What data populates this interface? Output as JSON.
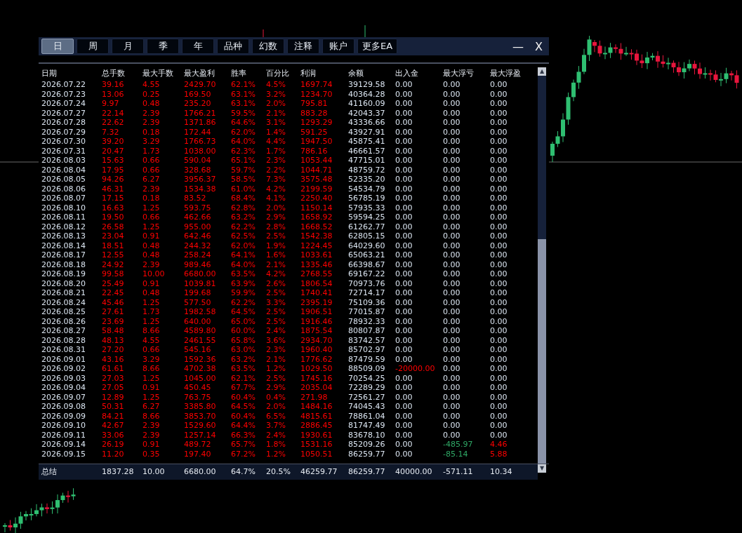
{
  "tabs": [
    {
      "label": "日",
      "selected": true
    },
    {
      "label": "周",
      "selected": false
    },
    {
      "label": "月",
      "selected": false
    },
    {
      "label": "季",
      "selected": false
    },
    {
      "label": "年",
      "selected": false
    },
    {
      "label": "品种",
      "selected": false
    },
    {
      "label": "幻数",
      "selected": false
    },
    {
      "label": "注释",
      "selected": false
    },
    {
      "label": "账户",
      "selected": false
    },
    {
      "label": "更多EA",
      "selected": false
    }
  ],
  "window_controls": {
    "minimize": "—",
    "close": "X"
  },
  "table": {
    "columns": [
      {
        "label": "日期",
        "color": "#dce6f2"
      },
      {
        "label": "总手数",
        "color": "#ff0000"
      },
      {
        "label": "最大手数",
        "color": "#ff0000"
      },
      {
        "label": "最大盈利",
        "color": "#ff0000"
      },
      {
        "label": "胜率",
        "color": "#ff0000"
      },
      {
        "label": "百分比",
        "color": "#ff0000"
      },
      {
        "label": "利润",
        "color": "#ff0000"
      },
      {
        "label": "余额",
        "color": "#dce6f2"
      },
      {
        "label": "出入金",
        "color": "#dce6f2"
      },
      {
        "label": "最大浮亏",
        "color": "#dce6f2"
      },
      {
        "label": "最大浮盈",
        "color": "#dce6f2"
      }
    ],
    "rows": [
      [
        "2026.07.22",
        "39.16",
        "4.55",
        "2429.70",
        "62.1%",
        "4.5%",
        "1697.74",
        "39129.58",
        "0.00",
        "0.00",
        "0.00"
      ],
      [
        "2026.07.23",
        "13.06",
        "0.25",
        "169.50",
        "63.1%",
        "3.2%",
        "1234.70",
        "40364.28",
        "0.00",
        "0.00",
        "0.00"
      ],
      [
        "2026.07.24",
        "9.97",
        "0.48",
        "235.20",
        "63.1%",
        "2.0%",
        "795.81",
        "41160.09",
        "0.00",
        "0.00",
        "0.00"
      ],
      [
        "2026.07.27",
        "22.14",
        "2.39",
        "1766.21",
        "59.5%",
        "2.1%",
        "883.28",
        "42043.37",
        "0.00",
        "0.00",
        "0.00"
      ],
      [
        "2026.07.28",
        "22.62",
        "2.39",
        "1371.86",
        "64.6%",
        "3.1%",
        "1293.29",
        "43336.66",
        "0.00",
        "0.00",
        "0.00"
      ],
      [
        "2026.07.29",
        "7.32",
        "0.18",
        "172.44",
        "62.0%",
        "1.4%",
        "591.25",
        "43927.91",
        "0.00",
        "0.00",
        "0.00"
      ],
      [
        "2026.07.30",
        "39.20",
        "3.29",
        "1766.73",
        "64.0%",
        "4.4%",
        "1947.50",
        "45875.41",
        "0.00",
        "0.00",
        "0.00"
      ],
      [
        "2026.07.31",
        "20.47",
        "1.73",
        "1038.00",
        "62.3%",
        "1.7%",
        "786.16",
        "46661.57",
        "0.00",
        "0.00",
        "0.00"
      ],
      [
        "2026.08.03",
        "15.63",
        "0.66",
        "590.04",
        "65.1%",
        "2.3%",
        "1053.44",
        "47715.01",
        "0.00",
        "0.00",
        "0.00"
      ],
      [
        "2026.08.04",
        "17.95",
        "0.66",
        "328.68",
        "59.7%",
        "2.2%",
        "1044.71",
        "48759.72",
        "0.00",
        "0.00",
        "0.00"
      ],
      [
        "2026.08.05",
        "94.26",
        "6.27",
        "3956.37",
        "58.5%",
        "7.3%",
        "3575.48",
        "52335.20",
        "0.00",
        "0.00",
        "0.00"
      ],
      [
        "2026.08.06",
        "46.31",
        "2.39",
        "1534.38",
        "61.0%",
        "4.2%",
        "2199.59",
        "54534.79",
        "0.00",
        "0.00",
        "0.00"
      ],
      [
        "2026.08.07",
        "17.15",
        "0.18",
        "83.52",
        "68.4%",
        "4.1%",
        "2250.40",
        "56785.19",
        "0.00",
        "0.00",
        "0.00"
      ],
      [
        "2026.08.10",
        "16.63",
        "1.25",
        "593.75",
        "62.8%",
        "2.0%",
        "1150.14",
        "57935.33",
        "0.00",
        "0.00",
        "0.00"
      ],
      [
        "2026.08.11",
        "19.50",
        "0.66",
        "462.66",
        "63.2%",
        "2.9%",
        "1658.92",
        "59594.25",
        "0.00",
        "0.00",
        "0.00"
      ],
      [
        "2026.08.12",
        "26.58",
        "1.25",
        "955.00",
        "62.2%",
        "2.8%",
        "1668.52",
        "61262.77",
        "0.00",
        "0.00",
        "0.00"
      ],
      [
        "2026.08.13",
        "23.04",
        "0.91",
        "642.46",
        "62.5%",
        "2.5%",
        "1542.38",
        "62805.15",
        "0.00",
        "0.00",
        "0.00"
      ],
      [
        "2026.08.14",
        "18.51",
        "0.48",
        "244.32",
        "62.0%",
        "1.9%",
        "1224.45",
        "64029.60",
        "0.00",
        "0.00",
        "0.00"
      ],
      [
        "2026.08.17",
        "12.55",
        "0.48",
        "258.24",
        "64.1%",
        "1.6%",
        "1033.61",
        "65063.21",
        "0.00",
        "0.00",
        "0.00"
      ],
      [
        "2026.08.18",
        "24.92",
        "2.39",
        "989.46",
        "64.0%",
        "2.1%",
        "1335.46",
        "66398.67",
        "0.00",
        "0.00",
        "0.00"
      ],
      [
        "2026.08.19",
        "99.58",
        "10.00",
        "6680.00",
        "63.5%",
        "4.2%",
        "2768.55",
        "69167.22",
        "0.00",
        "0.00",
        "0.00"
      ],
      [
        "2026.08.20",
        "25.49",
        "0.91",
        "1039.81",
        "63.9%",
        "2.6%",
        "1806.54",
        "70973.76",
        "0.00",
        "0.00",
        "0.00"
      ],
      [
        "2026.08.21",
        "22.45",
        "0.48",
        "199.68",
        "59.9%",
        "2.5%",
        "1740.41",
        "72714.17",
        "0.00",
        "0.00",
        "0.00"
      ],
      [
        "2026.08.24",
        "45.46",
        "1.25",
        "577.50",
        "62.2%",
        "3.3%",
        "2395.19",
        "75109.36",
        "0.00",
        "0.00",
        "0.00"
      ],
      [
        "2026.08.25",
        "27.61",
        "1.73",
        "1982.58",
        "64.5%",
        "2.5%",
        "1906.51",
        "77015.87",
        "0.00",
        "0.00",
        "0.00"
      ],
      [
        "2026.08.26",
        "23.69",
        "1.25",
        "640.00",
        "65.0%",
        "2.5%",
        "1916.46",
        "78932.33",
        "0.00",
        "0.00",
        "0.00"
      ],
      [
        "2026.08.27",
        "58.48",
        "8.66",
        "4589.80",
        "60.0%",
        "2.4%",
        "1875.54",
        "80807.87",
        "0.00",
        "0.00",
        "0.00"
      ],
      [
        "2026.08.28",
        "48.13",
        "4.55",
        "2461.55",
        "65.8%",
        "3.6%",
        "2934.70",
        "83742.57",
        "0.00",
        "0.00",
        "0.00"
      ],
      [
        "2026.08.31",
        "27.20",
        "0.66",
        "545.16",
        "63.0%",
        "2.3%",
        "1960.40",
        "85702.97",
        "0.00",
        "0.00",
        "0.00"
      ],
      [
        "2026.09.01",
        "43.16",
        "3.29",
        "1592.36",
        "63.2%",
        "2.1%",
        "1776.62",
        "87479.59",
        "0.00",
        "0.00",
        "0.00"
      ],
      [
        "2026.09.02",
        "61.61",
        "8.66",
        "4702.38",
        "63.5%",
        "1.2%",
        "1029.50",
        "88509.09",
        {
          "text": "-20000.00",
          "color": "#ff0000"
        },
        "0.00",
        "0.00"
      ],
      [
        "2026.09.03",
        "27.03",
        "1.25",
        "1045.00",
        "62.1%",
        "2.5%",
        "1745.16",
        "70254.25",
        "0.00",
        "0.00",
        "0.00"
      ],
      [
        "2026.09.04",
        "27.05",
        "0.91",
        "450.45",
        "67.7%",
        "2.9%",
        "2035.04",
        "72289.29",
        "0.00",
        "0.00",
        "0.00"
      ],
      [
        "2026.09.07",
        "12.89",
        "1.25",
        "763.75",
        "60.4%",
        "0.4%",
        "271.98",
        "72561.27",
        "0.00",
        "0.00",
        "0.00"
      ],
      [
        "2026.09.08",
        "50.31",
        "6.27",
        "3385.80",
        "64.5%",
        "2.0%",
        "1484.16",
        "74045.43",
        "0.00",
        "0.00",
        "0.00"
      ],
      [
        "2026.09.09",
        "84.21",
        "8.66",
        "3853.70",
        "60.4%",
        "6.5%",
        "4815.61",
        "78861.04",
        "0.00",
        "0.00",
        "0.00"
      ],
      [
        "2026.09.10",
        "42.67",
        "2.39",
        "1529.60",
        "64.4%",
        "3.7%",
        "2886.45",
        "81747.49",
        "0.00",
        "0.00",
        "0.00"
      ],
      [
        "2026.09.11",
        "33.06",
        "2.39",
        "1257.14",
        "66.3%",
        "2.4%",
        "1930.61",
        "83678.10",
        "0.00",
        "0.00",
        "0.00"
      ],
      [
        "2026.09.14",
        "26.19",
        "0.91",
        "489.72",
        "65.7%",
        "1.8%",
        "1531.16",
        "85209.26",
        "0.00",
        {
          "text": "-485.97",
          "color": "#2fa866"
        },
        {
          "text": "4.46",
          "color": "#ff0000"
        }
      ],
      [
        "2026.09.15",
        "11.20",
        "0.35",
        "197.40",
        "67.2%",
        "1.2%",
        "1050.51",
        "86259.77",
        "0.00",
        {
          "text": "-85.14",
          "color": "#2fa866"
        },
        {
          "text": "5.88",
          "color": "#ff0000"
        }
      ]
    ],
    "summary": [
      "总结",
      "1837.28",
      "10.00",
      "6680.00",
      "64.7%",
      "20.5%",
      "46259.77",
      "86259.77",
      "40000.00",
      "-571.11",
      "10.34"
    ]
  },
  "scrollbar": {
    "up": "▲",
    "down": "▼"
  }
}
